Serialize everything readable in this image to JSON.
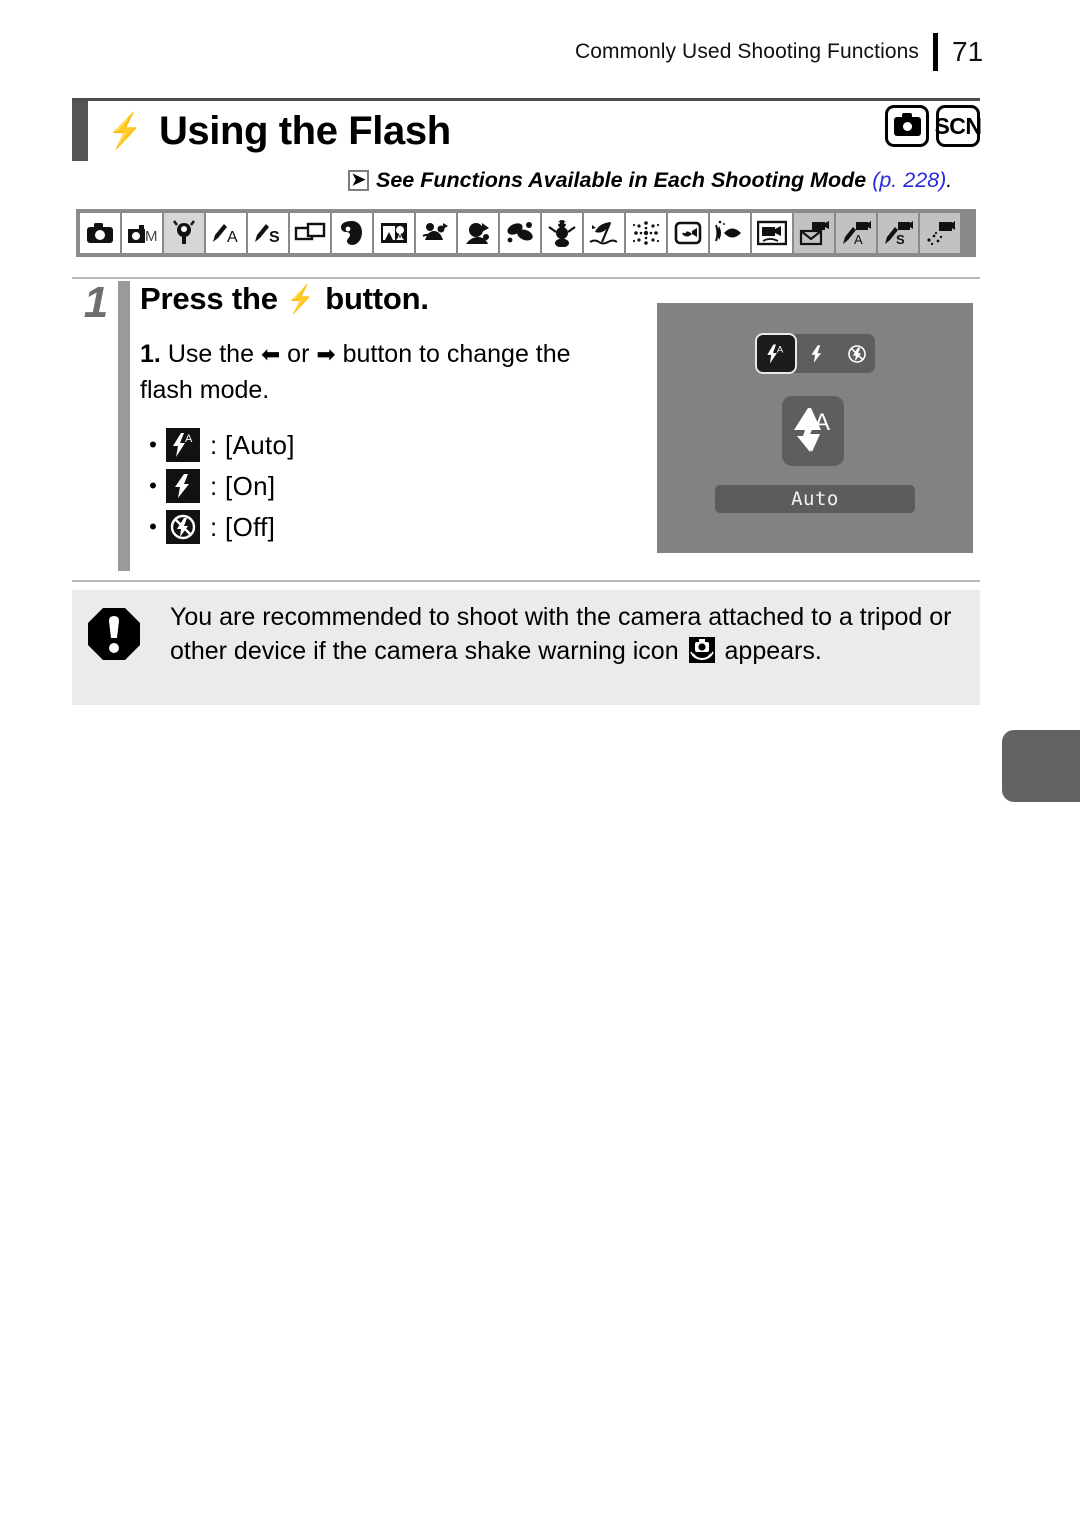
{
  "header": {
    "title": "Commonly Used Shooting Functions",
    "page_number": "71"
  },
  "title_section": {
    "flash_icon": "flash-icon",
    "heading": "Using the Flash",
    "badges": [
      {
        "name": "camera-mode-badge",
        "label": ""
      },
      {
        "name": "scn-mode-badge",
        "label": "SCN"
      }
    ]
  },
  "reference": {
    "arrow_icon": "arrow-right-icon",
    "text": "See Functions Available in Each Shooting Mode",
    "page_link": "(p. 228)",
    "trailing": "."
  },
  "mode_strip": {
    "icons": [
      "auto-mode-icon",
      "manual-mode-icon",
      "digital-macro-icon",
      "aperture-priority-icon",
      "shutter-priority-icon",
      "stitch-assist-icon",
      "portrait-icon",
      "night-snapshot-icon",
      "kids-and-pets-icon",
      "indoor-icon",
      "foliage-icon",
      "snow-icon",
      "beach-icon",
      "fireworks-icon",
      "aquarium-icon",
      "underwater-icon",
      "movie-standard-icon",
      "movie-compact-icon",
      "movie-color-accent-icon",
      "movie-color-swap-icon",
      "movie-fast-frame-icon"
    ],
    "highlighted_index": 2
  },
  "step": {
    "number": "1",
    "title_prefix": "Press the",
    "title_icon": "flash-icon",
    "title_suffix": "button.",
    "substep_number": "1.",
    "substep_text_a": "Use the",
    "left_arrow": "←",
    "substep_or": "or",
    "right_arrow": "→",
    "substep_text_b": "button to change the flash mode.",
    "bullets": [
      {
        "icon": "flash-auto-icon",
        "label": ": [Auto]"
      },
      {
        "icon": "flash-on-icon",
        "label": ": [On]"
      },
      {
        "icon": "flash-off-icon",
        "label": ": [Off]"
      }
    ]
  },
  "lcd": {
    "selector_items": [
      {
        "icon": "flash-auto-icon",
        "selected": true
      },
      {
        "icon": "flash-on-icon",
        "selected": false
      },
      {
        "icon": "flash-off-icon",
        "selected": false
      }
    ],
    "big_icon": "flash-auto-icon",
    "label": "Auto"
  },
  "note": {
    "icon": "warning-exclamation-icon",
    "text_a": "You are recommended to shoot with the camera attached to a tripod or other device if the camera shake warning icon",
    "inline_icon": "camera-shake-warning-icon",
    "text_b": "appears."
  },
  "thumb_tab": {
    "name": "chapter-thumb-tab"
  },
  "colors": {
    "accent_link": "#2b2bd8",
    "strip_bg": "#8a8a8a",
    "lcd_bg": "#828282",
    "note_bg": "#ebebeb",
    "step_bar": "#9a9a9a"
  }
}
